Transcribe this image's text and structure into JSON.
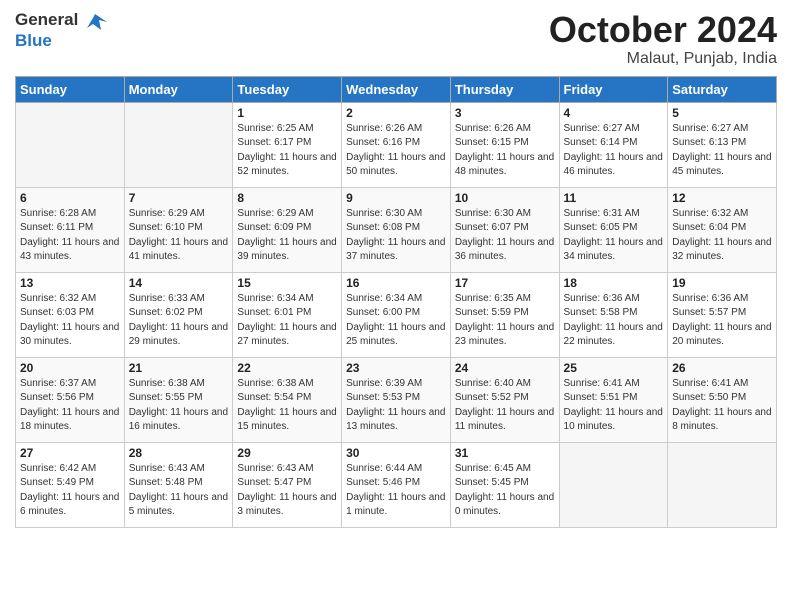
{
  "header": {
    "logo_general": "General",
    "logo_blue": "Blue",
    "month_title": "October 2024",
    "location": "Malaut, Punjab, India"
  },
  "days_of_week": [
    "Sunday",
    "Monday",
    "Tuesday",
    "Wednesday",
    "Thursday",
    "Friday",
    "Saturday"
  ],
  "weeks": [
    [
      {
        "day": "",
        "empty": true
      },
      {
        "day": "",
        "empty": true
      },
      {
        "day": "1",
        "sunrise": "Sunrise: 6:25 AM",
        "sunset": "Sunset: 6:17 PM",
        "daylight": "Daylight: 11 hours and 52 minutes."
      },
      {
        "day": "2",
        "sunrise": "Sunrise: 6:26 AM",
        "sunset": "Sunset: 6:16 PM",
        "daylight": "Daylight: 11 hours and 50 minutes."
      },
      {
        "day": "3",
        "sunrise": "Sunrise: 6:26 AM",
        "sunset": "Sunset: 6:15 PM",
        "daylight": "Daylight: 11 hours and 48 minutes."
      },
      {
        "day": "4",
        "sunrise": "Sunrise: 6:27 AM",
        "sunset": "Sunset: 6:14 PM",
        "daylight": "Daylight: 11 hours and 46 minutes."
      },
      {
        "day": "5",
        "sunrise": "Sunrise: 6:27 AM",
        "sunset": "Sunset: 6:13 PM",
        "daylight": "Daylight: 11 hours and 45 minutes."
      }
    ],
    [
      {
        "day": "6",
        "sunrise": "Sunrise: 6:28 AM",
        "sunset": "Sunset: 6:11 PM",
        "daylight": "Daylight: 11 hours and 43 minutes."
      },
      {
        "day": "7",
        "sunrise": "Sunrise: 6:29 AM",
        "sunset": "Sunset: 6:10 PM",
        "daylight": "Daylight: 11 hours and 41 minutes."
      },
      {
        "day": "8",
        "sunrise": "Sunrise: 6:29 AM",
        "sunset": "Sunset: 6:09 PM",
        "daylight": "Daylight: 11 hours and 39 minutes."
      },
      {
        "day": "9",
        "sunrise": "Sunrise: 6:30 AM",
        "sunset": "Sunset: 6:08 PM",
        "daylight": "Daylight: 11 hours and 37 minutes."
      },
      {
        "day": "10",
        "sunrise": "Sunrise: 6:30 AM",
        "sunset": "Sunset: 6:07 PM",
        "daylight": "Daylight: 11 hours and 36 minutes."
      },
      {
        "day": "11",
        "sunrise": "Sunrise: 6:31 AM",
        "sunset": "Sunset: 6:05 PM",
        "daylight": "Daylight: 11 hours and 34 minutes."
      },
      {
        "day": "12",
        "sunrise": "Sunrise: 6:32 AM",
        "sunset": "Sunset: 6:04 PM",
        "daylight": "Daylight: 11 hours and 32 minutes."
      }
    ],
    [
      {
        "day": "13",
        "sunrise": "Sunrise: 6:32 AM",
        "sunset": "Sunset: 6:03 PM",
        "daylight": "Daylight: 11 hours and 30 minutes."
      },
      {
        "day": "14",
        "sunrise": "Sunrise: 6:33 AM",
        "sunset": "Sunset: 6:02 PM",
        "daylight": "Daylight: 11 hours and 29 minutes."
      },
      {
        "day": "15",
        "sunrise": "Sunrise: 6:34 AM",
        "sunset": "Sunset: 6:01 PM",
        "daylight": "Daylight: 11 hours and 27 minutes."
      },
      {
        "day": "16",
        "sunrise": "Sunrise: 6:34 AM",
        "sunset": "Sunset: 6:00 PM",
        "daylight": "Daylight: 11 hours and 25 minutes."
      },
      {
        "day": "17",
        "sunrise": "Sunrise: 6:35 AM",
        "sunset": "Sunset: 5:59 PM",
        "daylight": "Daylight: 11 hours and 23 minutes."
      },
      {
        "day": "18",
        "sunrise": "Sunrise: 6:36 AM",
        "sunset": "Sunset: 5:58 PM",
        "daylight": "Daylight: 11 hours and 22 minutes."
      },
      {
        "day": "19",
        "sunrise": "Sunrise: 6:36 AM",
        "sunset": "Sunset: 5:57 PM",
        "daylight": "Daylight: 11 hours and 20 minutes."
      }
    ],
    [
      {
        "day": "20",
        "sunrise": "Sunrise: 6:37 AM",
        "sunset": "Sunset: 5:56 PM",
        "daylight": "Daylight: 11 hours and 18 minutes."
      },
      {
        "day": "21",
        "sunrise": "Sunrise: 6:38 AM",
        "sunset": "Sunset: 5:55 PM",
        "daylight": "Daylight: 11 hours and 16 minutes."
      },
      {
        "day": "22",
        "sunrise": "Sunrise: 6:38 AM",
        "sunset": "Sunset: 5:54 PM",
        "daylight": "Daylight: 11 hours and 15 minutes."
      },
      {
        "day": "23",
        "sunrise": "Sunrise: 6:39 AM",
        "sunset": "Sunset: 5:53 PM",
        "daylight": "Daylight: 11 hours and 13 minutes."
      },
      {
        "day": "24",
        "sunrise": "Sunrise: 6:40 AM",
        "sunset": "Sunset: 5:52 PM",
        "daylight": "Daylight: 11 hours and 11 minutes."
      },
      {
        "day": "25",
        "sunrise": "Sunrise: 6:41 AM",
        "sunset": "Sunset: 5:51 PM",
        "daylight": "Daylight: 11 hours and 10 minutes."
      },
      {
        "day": "26",
        "sunrise": "Sunrise: 6:41 AM",
        "sunset": "Sunset: 5:50 PM",
        "daylight": "Daylight: 11 hours and 8 minutes."
      }
    ],
    [
      {
        "day": "27",
        "sunrise": "Sunrise: 6:42 AM",
        "sunset": "Sunset: 5:49 PM",
        "daylight": "Daylight: 11 hours and 6 minutes."
      },
      {
        "day": "28",
        "sunrise": "Sunrise: 6:43 AM",
        "sunset": "Sunset: 5:48 PM",
        "daylight": "Daylight: 11 hours and 5 minutes."
      },
      {
        "day": "29",
        "sunrise": "Sunrise: 6:43 AM",
        "sunset": "Sunset: 5:47 PM",
        "daylight": "Daylight: 11 hours and 3 minutes."
      },
      {
        "day": "30",
        "sunrise": "Sunrise: 6:44 AM",
        "sunset": "Sunset: 5:46 PM",
        "daylight": "Daylight: 11 hours and 1 minute."
      },
      {
        "day": "31",
        "sunrise": "Sunrise: 6:45 AM",
        "sunset": "Sunset: 5:45 PM",
        "daylight": "Daylight: 11 hours and 0 minutes."
      },
      {
        "day": "",
        "empty": true
      },
      {
        "day": "",
        "empty": true
      }
    ]
  ]
}
